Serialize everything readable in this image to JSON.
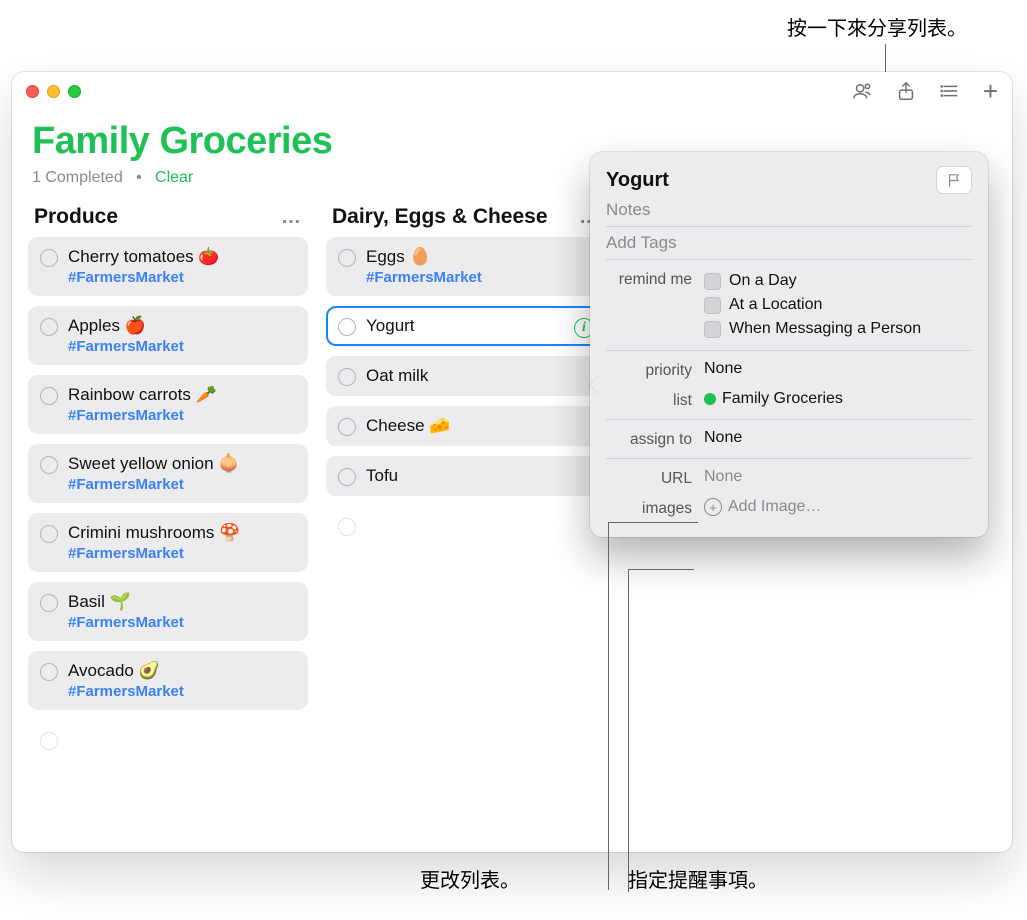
{
  "callouts": {
    "share": "按一下來分享列表。",
    "changeList": "更改列表。",
    "assign": "指定提醒事項。"
  },
  "header": {
    "title": "Family Groceries",
    "completed": "1 Completed",
    "dot": "•",
    "clear": "Clear"
  },
  "columns": {
    "produce": {
      "title": "Produce",
      "more": "…",
      "items": {
        "i0": {
          "title": "Cherry tomatoes 🍅",
          "tag": "#FarmersMarket"
        },
        "i1": {
          "title": "Apples 🍎",
          "tag": "#FarmersMarket"
        },
        "i2": {
          "title": "Rainbow carrots 🥕",
          "tag": "#FarmersMarket"
        },
        "i3": {
          "title": "Sweet yellow onion 🧅",
          "tag": "#FarmersMarket"
        },
        "i4": {
          "title": "Crimini mushrooms 🍄",
          "tag": "#FarmersMarket"
        },
        "i5": {
          "title": "Basil 🌱",
          "tag": "#FarmersMarket"
        },
        "i6": {
          "title": "Avocado 🥑",
          "tag": "#FarmersMarket"
        }
      }
    },
    "dairy": {
      "title": "Dairy, Eggs & Cheese",
      "more": "…",
      "items": {
        "i0": {
          "title": "Eggs 🥚",
          "tag": "#FarmersMarket"
        },
        "i1": {
          "title": "Yogurt"
        },
        "i2": {
          "title": "Oat milk"
        },
        "i3": {
          "title": "Cheese 🧀"
        },
        "i4": {
          "title": "Tofu"
        }
      }
    }
  },
  "popover": {
    "title": "Yogurt",
    "notesPlaceholder": "Notes",
    "tagsPlaceholder": "Add Tags",
    "labels": {
      "remind": "remind me",
      "priority": "priority",
      "list": "list",
      "assign": "assign to",
      "url": "URL",
      "images": "images"
    },
    "remind": {
      "onDay": "On a Day",
      "atLocation": "At a Location",
      "messaging": "When Messaging a Person"
    },
    "priority": "None",
    "listName": "Family Groceries",
    "assign": "None",
    "url": "None",
    "addImage": "Add Image…"
  }
}
